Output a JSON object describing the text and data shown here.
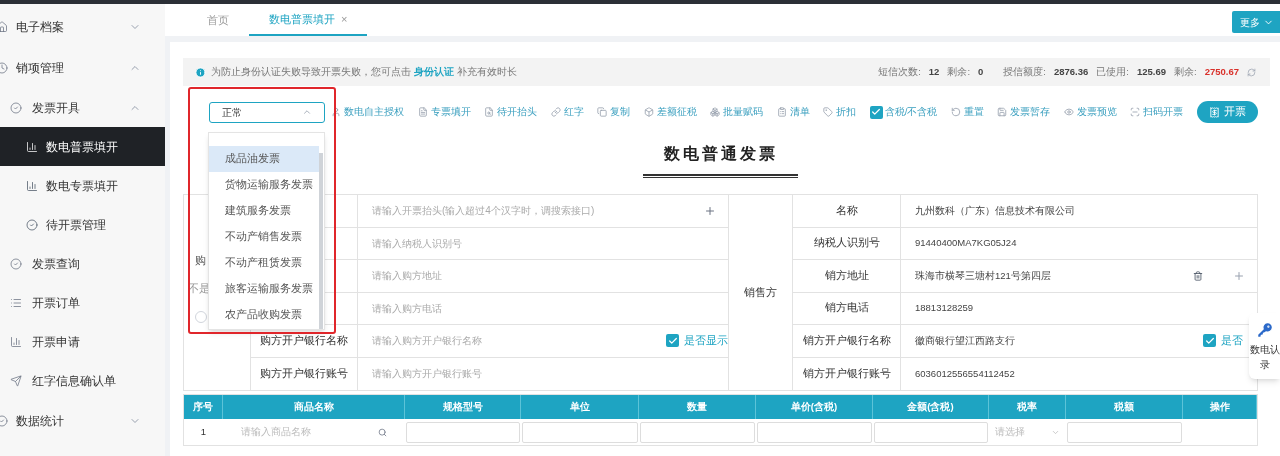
{
  "sidebar": {
    "items": [
      {
        "label": "电子档案",
        "expanded": false
      },
      {
        "label": "销项管理",
        "expanded": true,
        "children": [
          {
            "label": "发票开具",
            "expanded": true,
            "children": [
              {
                "label": "数电普票填开",
                "selected": true
              },
              {
                "label": "数电专票填开",
                "selected": false
              },
              {
                "label": "待开票管理",
                "selected": false
              }
            ]
          },
          {
            "label": "发票查询"
          },
          {
            "label": "开票订单"
          },
          {
            "label": "开票申请"
          },
          {
            "label": "红字信息确认单"
          }
        ]
      },
      {
        "label": "数据统计",
        "expanded": false
      }
    ]
  },
  "tabs": [
    {
      "label": "首页",
      "selected": false,
      "closable": false
    },
    {
      "label": "数电普票填开",
      "selected": true,
      "closable": true,
      "close": "×"
    }
  ],
  "more_button": "更多",
  "notice": {
    "before": "为防止身份认证失败导致开票失败，您可点击",
    "link": "身份认证",
    "after": "补充有效时长"
  },
  "stats": [
    {
      "label": "短信次数:",
      "value": "12",
      "highlight": false
    },
    {
      "label": "剩余:",
      "value": "0",
      "highlight": false
    },
    {
      "label": "授信额度:",
      "value": "2876.36",
      "highlight": false
    },
    {
      "label": "已使用:",
      "value": "125.69",
      "highlight": false
    },
    {
      "label": "剩余:",
      "value": "2750.67",
      "highlight": true
    }
  ],
  "invoice_type_select": {
    "value": "正常",
    "open": true,
    "options": [
      {
        "label": "成品油发票",
        "selected": true
      },
      {
        "label": "货物运输服务发票",
        "selected": false
      },
      {
        "label": "建筑服务发票",
        "selected": false
      },
      {
        "label": "不动产销售发票",
        "selected": false
      },
      {
        "label": "不动产租赁发票",
        "selected": false
      },
      {
        "label": "旅客运输服务发票",
        "selected": false
      },
      {
        "label": "农产品收购发票",
        "selected": false
      }
    ]
  },
  "toolbar": [
    {
      "kind": "link",
      "label": "数电自主授权"
    },
    {
      "kind": "link",
      "label": "专票填开"
    },
    {
      "kind": "link",
      "label": "待开抬头"
    },
    {
      "kind": "link",
      "label": "红字"
    },
    {
      "kind": "link",
      "label": "复制"
    },
    {
      "kind": "link",
      "label": "差额征税"
    },
    {
      "kind": "link",
      "label": "批量赋码"
    },
    {
      "kind": "link",
      "label": "清单"
    },
    {
      "kind": "link",
      "label": "折扣"
    },
    {
      "kind": "checkbox",
      "label": "含税/不含税",
      "checked": true
    },
    {
      "kind": "link",
      "label": "重置"
    },
    {
      "kind": "link",
      "label": "发票暂存"
    },
    {
      "kind": "link",
      "label": "发票预览"
    },
    {
      "kind": "link",
      "label": "扫码开票"
    },
    {
      "kind": "primary",
      "label": "开票"
    }
  ],
  "invoice_title": "数电普通发票",
  "buyer": {
    "fragments": [
      "购",
      "不是"
    ],
    "rows": [
      {
        "placeholder": "请输入开票抬头(输入超过4个汉字时，调搜索接口)",
        "add": true
      },
      {
        "placeholder": "请输入纳税人识别号"
      },
      {
        "placeholder": "请输入购方地址"
      },
      {
        "placeholder": "请输入购方电话"
      },
      {
        "label": "购方开户银行名称",
        "placeholder": "请输入购方开户银行名称",
        "show_toggle": {
          "label": "是否显示",
          "checked": true
        }
      },
      {
        "label": "购方开户银行账号",
        "placeholder": "请输入购方开户银行账号"
      }
    ]
  },
  "seller": {
    "title": "销售方",
    "rows": [
      {
        "label": "名称",
        "value": "九州数科（广东）信息技术有限公司"
      },
      {
        "label": "纳税人识别号",
        "value": "91440400MA7KG05J24"
      },
      {
        "label": "销方地址",
        "value": "珠海市横琴三塘村121号第四层",
        "delete": true,
        "add": true
      },
      {
        "label": "销方电话",
        "value": "18813128259"
      },
      {
        "label": "销方开户银行名称",
        "value": "徽商银行望江西路支行",
        "show_toggle": {
          "label": "是否",
          "checked": true
        }
      },
      {
        "label": "销方开户银行账号",
        "value": "6036012556554112452"
      }
    ]
  },
  "items_table": {
    "columns": [
      "序号",
      "商品名称",
      "规格型号",
      "单位",
      "数量",
      "单价(含税)",
      "金额(含税)",
      "税率",
      "税额",
      "操作"
    ],
    "rows": [
      {
        "index": "1",
        "name_placeholder": "请输入商品名称",
        "rate_placeholder": "请选择"
      }
    ]
  },
  "floating_widget": {
    "lines": [
      "数电认",
      "录"
    ]
  }
}
